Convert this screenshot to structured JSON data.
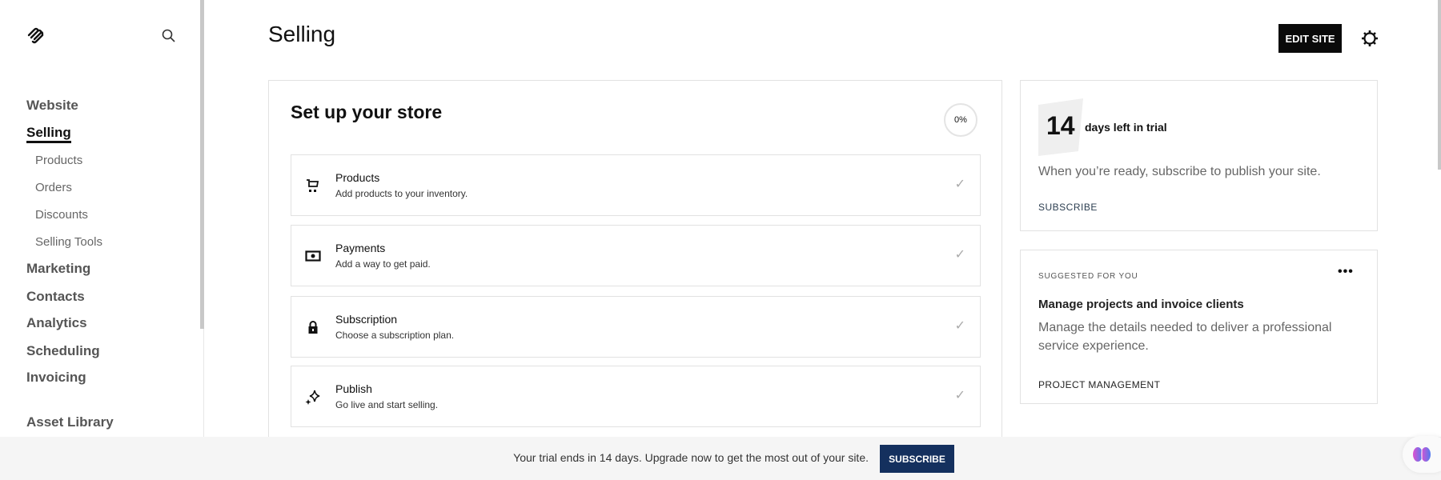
{
  "sidebar": {
    "items": [
      {
        "label": "Website"
      },
      {
        "label": "Selling",
        "active": true
      },
      {
        "label": "Products"
      },
      {
        "label": "Orders"
      },
      {
        "label": "Discounts"
      },
      {
        "label": "Selling Tools"
      },
      {
        "label": "Marketing"
      },
      {
        "label": "Contacts"
      },
      {
        "label": "Analytics"
      },
      {
        "label": "Scheduling"
      },
      {
        "label": "Invoicing"
      },
      {
        "label": "Asset Library"
      }
    ]
  },
  "header": {
    "title": "Selling",
    "edit_site": "EDIT SITE"
  },
  "setup": {
    "title": "Set up your store",
    "progress": "0%",
    "steps": [
      {
        "title": "Products",
        "desc": "Add products to your inventory.",
        "icon": "cart-icon"
      },
      {
        "title": "Payments",
        "desc": "Add a way to get paid.",
        "icon": "money-icon"
      },
      {
        "title": "Subscription",
        "desc": "Choose a subscription plan.",
        "icon": "lock-icon"
      },
      {
        "title": "Publish",
        "desc": "Go live and start selling.",
        "icon": "sparkle-icon"
      }
    ]
  },
  "trial": {
    "days": "14",
    "label": "days left in trial",
    "text": "When you’re ready, subscribe to publish your site.",
    "link": "SUBSCRIBE"
  },
  "suggested": {
    "eyebrow": "SUGGESTED FOR YOU",
    "title": "Manage projects and invoice clients",
    "text": "Manage the details needed to deliver a professional service experience.",
    "link": "PROJECT MANAGEMENT"
  },
  "banner": {
    "text": "Your trial ends in 14 days. Upgrade now to get the most out of your site.",
    "button": "SUBSCRIBE",
    "button_color": "#14305e"
  }
}
